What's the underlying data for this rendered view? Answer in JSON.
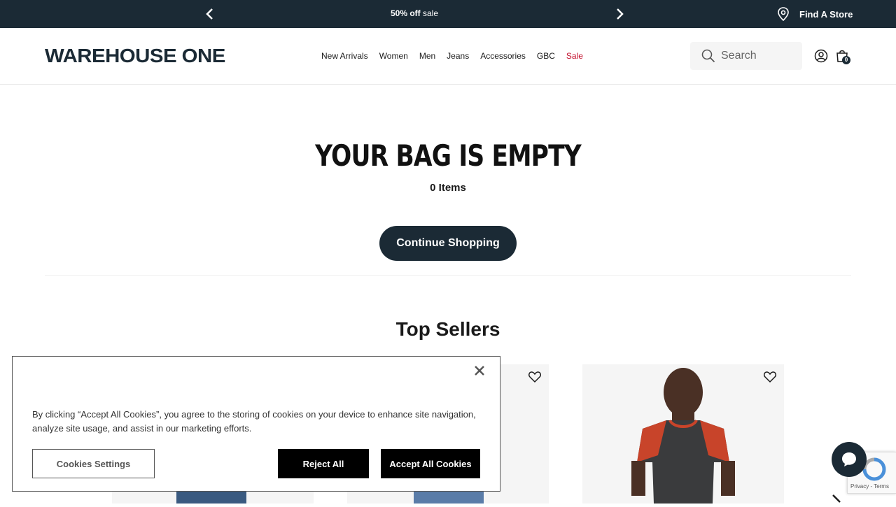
{
  "promo": {
    "bold": "50% off",
    "rest": " sale",
    "find_store": "Find A Store"
  },
  "header": {
    "logo": "WAREHOUSE ONE",
    "nav": [
      {
        "label": "New Arrivals"
      },
      {
        "label": "Women"
      },
      {
        "label": "Men"
      },
      {
        "label": "Jeans"
      },
      {
        "label": "Accessories"
      },
      {
        "label": "GBC"
      },
      {
        "label": "Sale"
      }
    ],
    "search_placeholder": "Search",
    "bag_count": "0"
  },
  "main": {
    "title": "YOUR BAG IS EMPTY",
    "items": "0 Items",
    "continue": "Continue Shopping",
    "top_sellers": "Top Sellers"
  },
  "cookie": {
    "text": "By clicking “Accept All Cookies”, you agree to the storing of cookies on your device to enhance site navigation, analyze site usage, and assist in our marketing efforts.",
    "settings": "Cookies Settings",
    "reject": "Reject All",
    "accept": "Accept All Cookies"
  },
  "recaptcha": {
    "text": "Privacy - Terms"
  },
  "colors": {
    "brand_navy": "#1b2a35",
    "sale_red": "#c4122f"
  },
  "icons": [
    "chevron-left-icon",
    "chevron-right-icon",
    "location-pin-icon",
    "search-icon",
    "account-icon",
    "bag-icon",
    "heart-icon",
    "close-icon",
    "chat-icon"
  ]
}
